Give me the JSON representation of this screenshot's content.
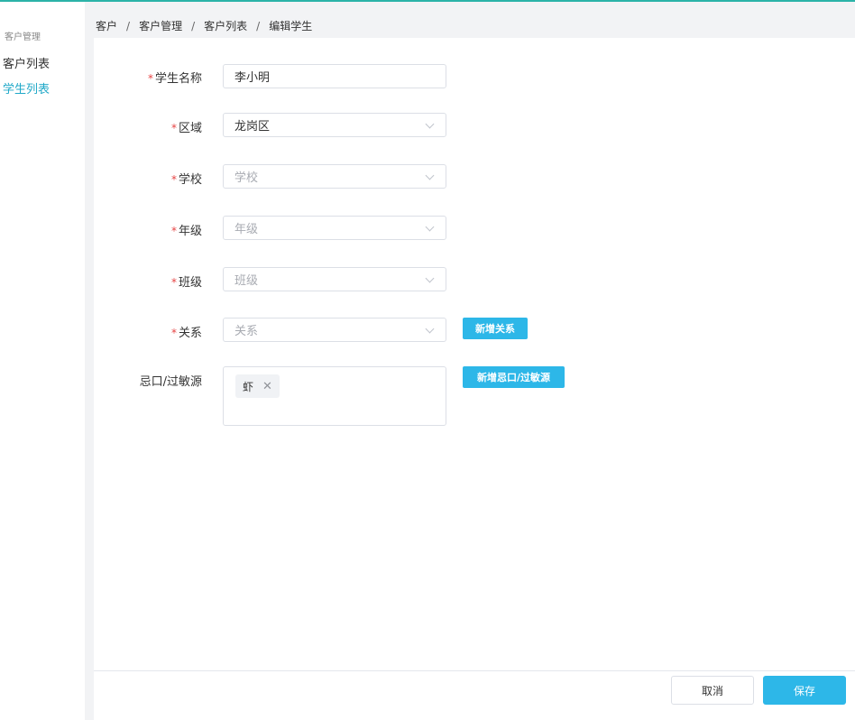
{
  "sidebar": {
    "group_title": "客户管理",
    "items": [
      {
        "label": "客户列表"
      },
      {
        "label": "学生列表",
        "active": true
      }
    ]
  },
  "breadcrumb": {
    "items": [
      "客户",
      "客户管理",
      "客户列表",
      "编辑学生"
    ],
    "separator": "/"
  },
  "form": {
    "required_mark": "*",
    "name": {
      "label": "学生名称",
      "value": "李小明"
    },
    "region": {
      "label": "区域",
      "value": "龙岗区"
    },
    "school": {
      "label": "学校",
      "placeholder": "学校"
    },
    "grade": {
      "label": "年级",
      "placeholder": "年级"
    },
    "class": {
      "label": "班级",
      "placeholder": "班级"
    },
    "relation": {
      "label": "关系",
      "placeholder": "关系",
      "add_button": "新增关系"
    },
    "allergy": {
      "label": "忌口/过敏源",
      "tags": [
        "虾"
      ],
      "add_button": "新增忌口/过敏源"
    }
  },
  "footer": {
    "cancel_label": "取消",
    "save_label": "保存"
  },
  "colors": {
    "accent": "#2db7e8",
    "active_nav": "#20a8c8",
    "required": "#e64444"
  }
}
